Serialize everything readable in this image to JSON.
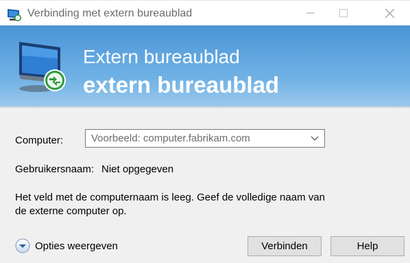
{
  "window": {
    "title": "Verbinding met extern bureaublad",
    "icon": "remote-desktop-icon"
  },
  "banner": {
    "line1": "Extern bureaublad",
    "line2": "extern bureaublad",
    "icon": "remote-desktop-monitor-icon",
    "gradient_top": "#4a93d6",
    "gradient_bottom": "#84bde9"
  },
  "form": {
    "computer_label": "Computer:",
    "computer_value": "Voorbeeld: computer.fabrikam.com",
    "username_label": "Gebruikersnaam:",
    "username_value": "Niet opgegeven",
    "info_text": "Het veld met de computernaam is leeg. Geef de volledige naam van de externe computer op."
  },
  "footer": {
    "options_label": "Opties weergeven",
    "connect_label": "Verbinden",
    "help_label": "Help"
  }
}
